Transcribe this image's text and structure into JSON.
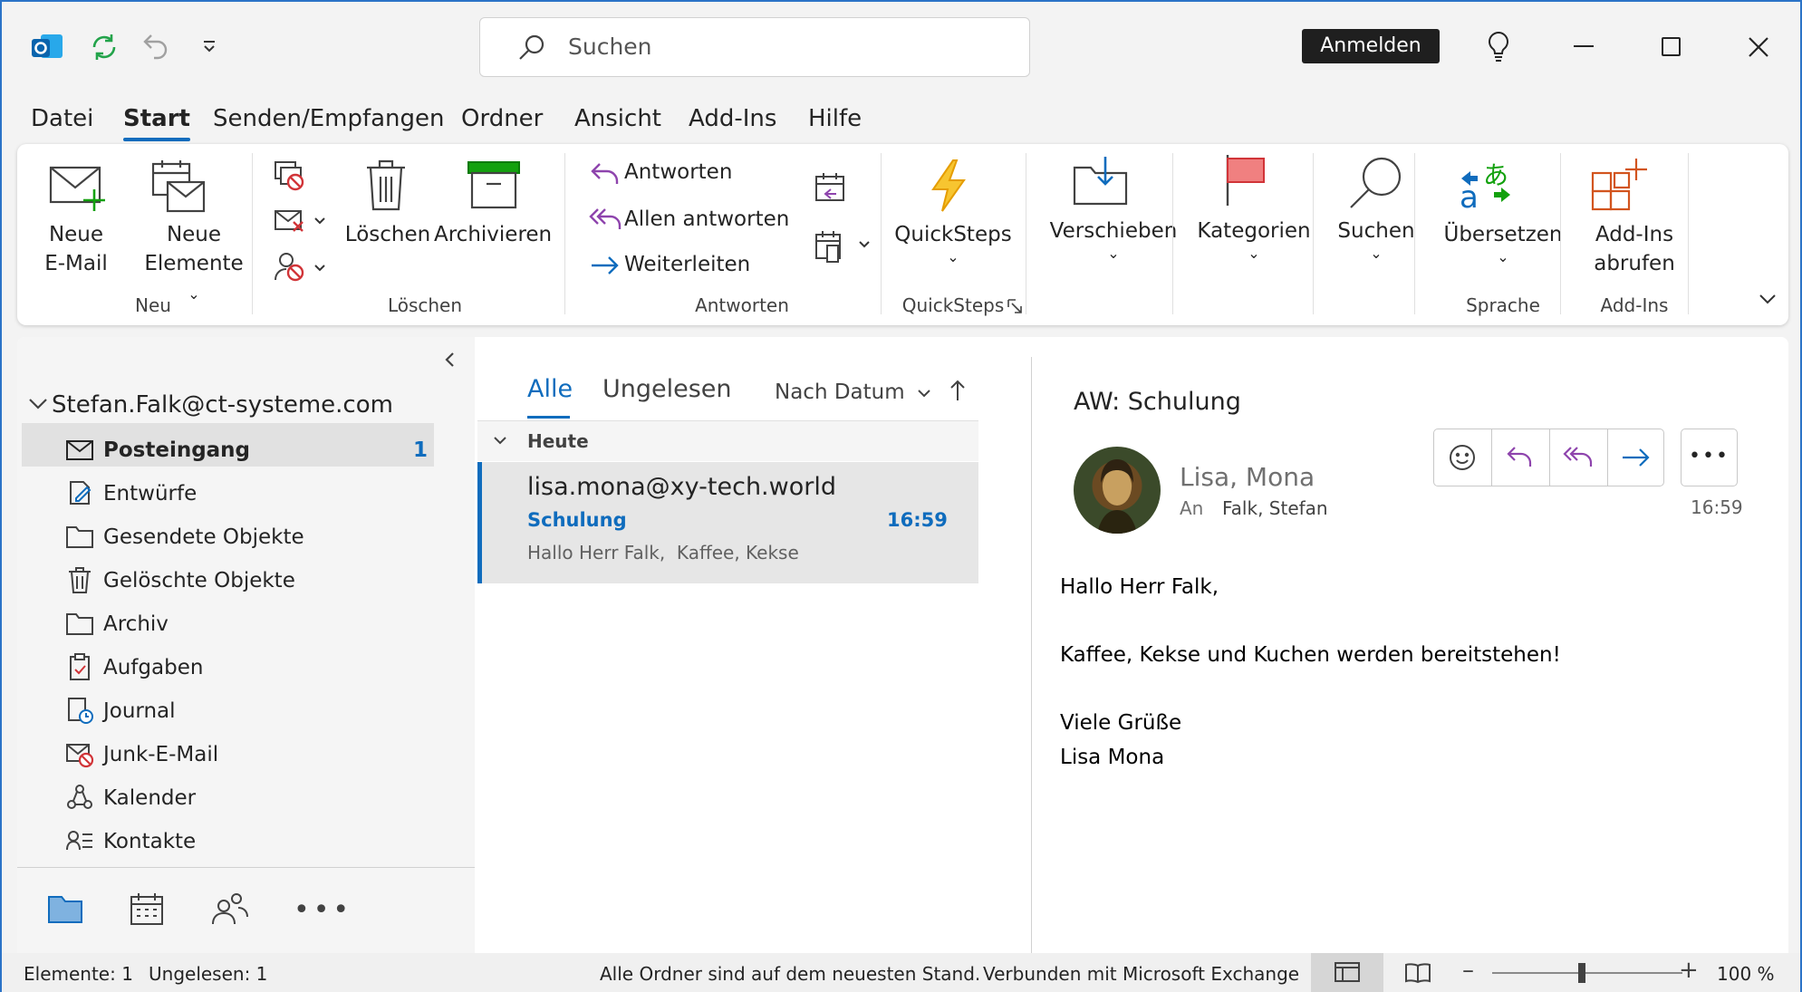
{
  "titlebar": {
    "search_placeholder": "Suchen",
    "signin_label": "Anmelden"
  },
  "menu": [
    "Datei",
    "Start",
    "Senden/Empfangen",
    "Ordner",
    "Ansicht",
    "Add-Ins",
    "Hilfe"
  ],
  "ribbon": {
    "neue_email": [
      "Neue",
      "E-Mail"
    ],
    "neue_elemente": [
      "Neue",
      "Elemente"
    ],
    "group_neu": "Neu",
    "loeschen": "Löschen",
    "archivieren": "Archivieren",
    "group_loeschen": "Löschen",
    "antworten": "Antworten",
    "allen_antworten": "Allen antworten",
    "weiterleiten": "Weiterleiten",
    "group_antworten": "Antworten",
    "quicksteps": "QuickSteps",
    "group_quicksteps": "QuickSteps",
    "verschieben": "Verschieben",
    "kategorien": "Kategorien",
    "suchen": "Suchen",
    "uebersetzen": "Übersetzen",
    "group_sprache": "Sprache",
    "addins": [
      "Add-Ins",
      "abrufen"
    ],
    "group_addins": "Add-Ins"
  },
  "folders": {
    "account": "Stefan.Falk@ct-systeme.com",
    "items": [
      {
        "label": "Posteingang",
        "count": "1"
      },
      {
        "label": "Entwürfe"
      },
      {
        "label": "Gesendete Objekte"
      },
      {
        "label": "Gelöschte Objekte"
      },
      {
        "label": "Archiv"
      },
      {
        "label": "Aufgaben"
      },
      {
        "label": "Journal"
      },
      {
        "label": "Junk-E-Mail"
      },
      {
        "label": "Kalender"
      },
      {
        "label": "Kontakte"
      }
    ]
  },
  "maillist": {
    "tab_all": "Alle",
    "tab_unread": "Ungelesen",
    "sort": "Nach Datum",
    "group": "Heute",
    "message": {
      "from": "lisa.mona@xy-tech.world",
      "subject": "Schulung",
      "time": "16:59",
      "preview": "Hallo Herr Falk,  Kaffee, Kekse"
    }
  },
  "reading": {
    "subject": "AW: Schulung",
    "sender": "Lisa, Mona",
    "to_label": "An",
    "to": "Falk, Stefan",
    "time": "16:59",
    "body": [
      "Hallo Herr Falk,",
      "Kaffee, Kekse und Kuchen werden bereitstehen!",
      "Viele Grüße",
      "Lisa Mona"
    ]
  },
  "status": {
    "items": "Elemente: 1",
    "unread": "Ungelesen: 1",
    "sync": "Alle Ordner sind auf dem neuesten Stand.",
    "connection": "Verbunden mit Microsoft Exchange",
    "zoom": "100 %"
  },
  "colors": {
    "accent": "#0f6cbd",
    "window_border": "#2b73c7"
  }
}
